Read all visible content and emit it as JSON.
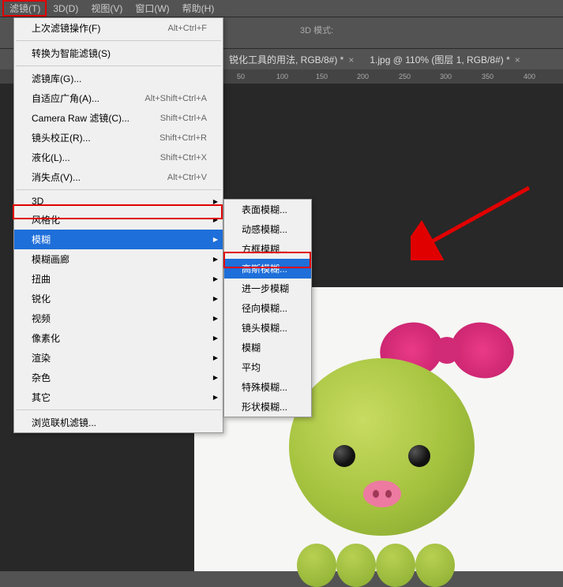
{
  "menubar": [
    "滤镜(T)",
    "3D(D)",
    "视图(V)",
    "窗口(W)",
    "帮助(H)"
  ],
  "toolbar_3d_mode": "3D 模式:",
  "tabs": [
    {
      "label": "锐化工具的用法, RGB/8#) *"
    },
    {
      "label": "1.jpg @ 110% (图层 1, RGB/8#) *"
    }
  ],
  "ruler": [
    "50",
    "100",
    "150",
    "200",
    "250",
    "300",
    "350",
    "400"
  ],
  "filter_menu": {
    "last": {
      "label": "上次滤镜操作(F)",
      "shortcut": "Alt+Ctrl+F"
    },
    "smart": "转换为智能滤镜(S)",
    "group1": [
      {
        "label": "滤镜库(G)...",
        "shortcut": ""
      },
      {
        "label": "自适应广角(A)...",
        "shortcut": "Alt+Shift+Ctrl+A"
      },
      {
        "label": "Camera Raw 滤镜(C)...",
        "shortcut": "Shift+Ctrl+A"
      },
      {
        "label": "镜头校正(R)...",
        "shortcut": "Shift+Ctrl+R"
      },
      {
        "label": "液化(L)...",
        "shortcut": "Shift+Ctrl+X"
      },
      {
        "label": "消失点(V)...",
        "shortcut": "Alt+Ctrl+V"
      }
    ],
    "group2": [
      "3D",
      "风格化",
      "模糊",
      "模糊画廊",
      "扭曲",
      "锐化",
      "视频",
      "像素化",
      "渲染",
      "杂色",
      "其它"
    ],
    "browse": "浏览联机滤镜..."
  },
  "blur_submenu": [
    "表面模糊...",
    "动感模糊...",
    "方框模糊...",
    "高斯模糊...",
    "进一步模糊",
    "径向模糊...",
    "镜头模糊...",
    "模糊",
    "平均",
    "特殊模糊...",
    "形状模糊..."
  ]
}
